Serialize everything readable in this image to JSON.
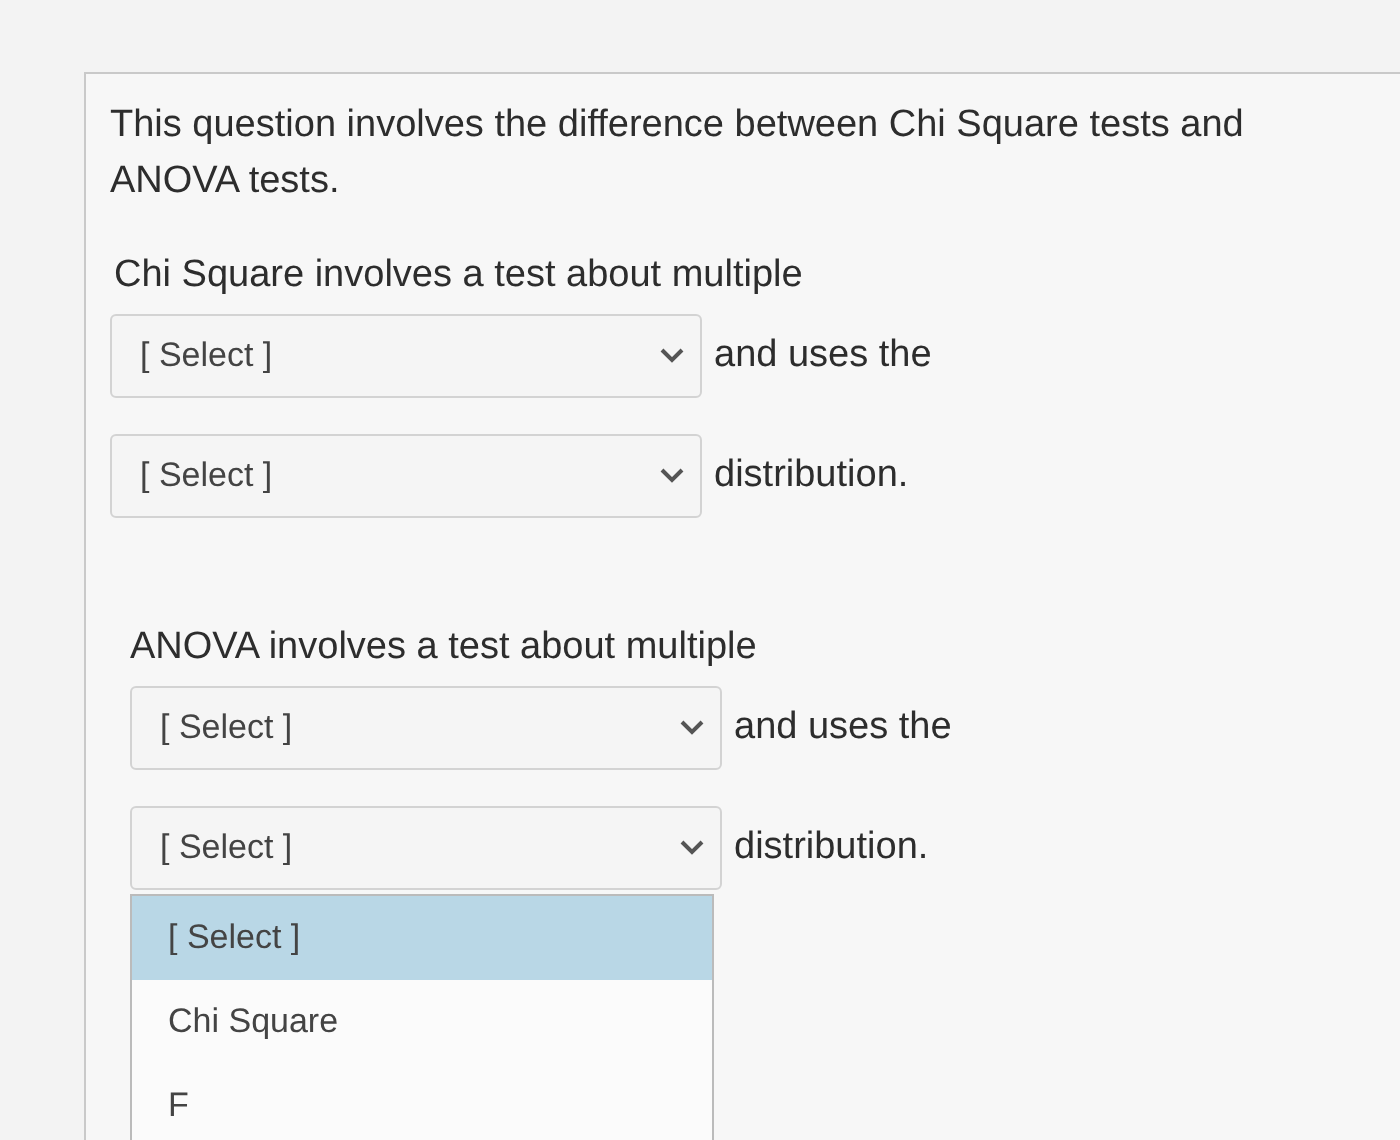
{
  "question": "This question involves the difference between Chi Square tests and ANOVA tests.",
  "parts": [
    {
      "prompt": "Chi Square involves a test about multiple",
      "blanks": [
        {
          "value": "[ Select ]",
          "suffix": "and uses the"
        },
        {
          "value": "[ Select ]",
          "suffix": "distribution."
        }
      ]
    },
    {
      "prompt": "ANOVA involves a test about multiple",
      "blanks": [
        {
          "value": "[ Select ]",
          "suffix": "and uses the"
        },
        {
          "value": "[ Select ]",
          "suffix": "distribution.",
          "expanded": true,
          "options": [
            {
              "label": "[ Select ]",
              "selected": true
            },
            {
              "label": "Chi Square",
              "selected": false
            },
            {
              "label": "F",
              "selected": false
            }
          ]
        }
      ]
    }
  ]
}
